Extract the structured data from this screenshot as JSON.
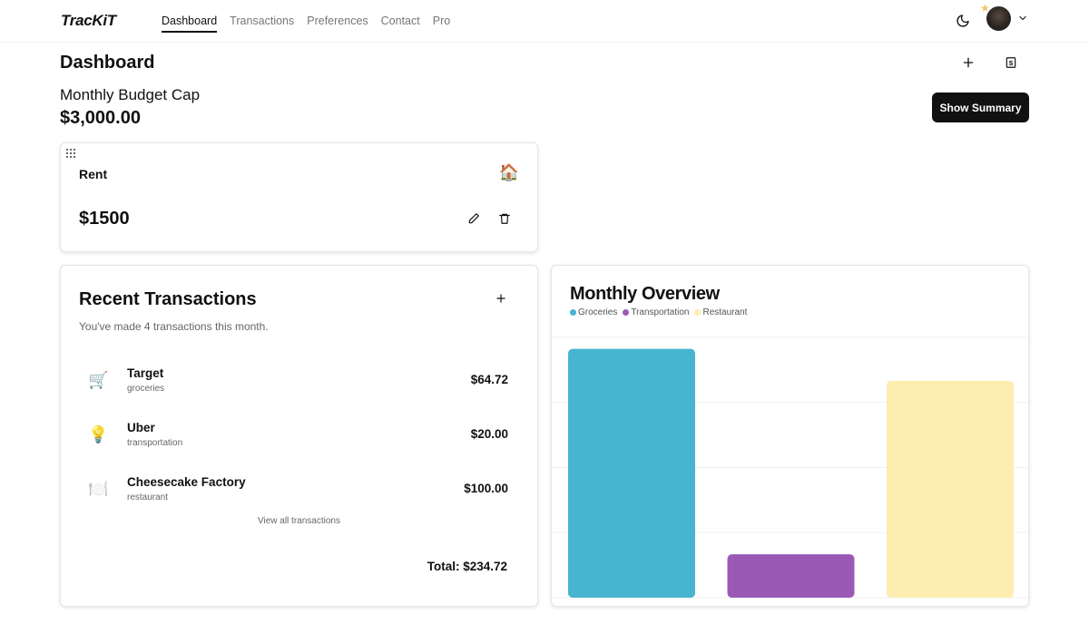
{
  "app": {
    "logo": "TracKiT"
  },
  "nav": {
    "items": [
      {
        "label": "Dashboard",
        "active": true
      },
      {
        "label": "Transactions",
        "active": false
      },
      {
        "label": "Preferences",
        "active": false
      },
      {
        "label": "Contact",
        "active": false
      },
      {
        "label": "Pro",
        "active": false
      }
    ],
    "icons": {
      "theme": "moon-icon",
      "avatar": "user-avatar",
      "menu": "chevron-down-icon"
    }
  },
  "page": {
    "title": "Dashboard",
    "budget_label": "Monthly Budget Cap",
    "budget_value": "$3,000.00",
    "show_summary_label": "Show Summary"
  },
  "budget_card": {
    "name": "Rent",
    "emoji": "🏠",
    "amount": "$1500"
  },
  "recent": {
    "title": "Recent Transactions",
    "subtitle": "You've made 4 transactions this month.",
    "items": [
      {
        "emoji": "🛒",
        "name": "Target",
        "category": "groceries",
        "amount": "$64.72"
      },
      {
        "emoji": "💡",
        "name": "Uber",
        "category": "transportation",
        "amount": "$20.00"
      },
      {
        "emoji": "🍽️",
        "name": "Cheesecake Factory",
        "category": "restaurant",
        "amount": "$100.00"
      }
    ],
    "view_all_label": "View all transactions",
    "total": "Total: $234.72"
  },
  "overview": {
    "title": "Monthly Overview"
  },
  "chart_data": {
    "type": "bar",
    "title": "Monthly Overview",
    "categories": [
      "Groceries",
      "Transportation",
      "Restaurant"
    ],
    "values": [
      114.72,
      20,
      100
    ],
    "colors": [
      "#47b4d0",
      "#9b59b6",
      "#fdedb0"
    ],
    "legend": "top-left",
    "grid": true,
    "ylim": [
      0,
      120
    ],
    "gridlines": [
      0,
      30,
      60,
      90,
      120
    ],
    "xlabel": "",
    "ylabel": ""
  }
}
